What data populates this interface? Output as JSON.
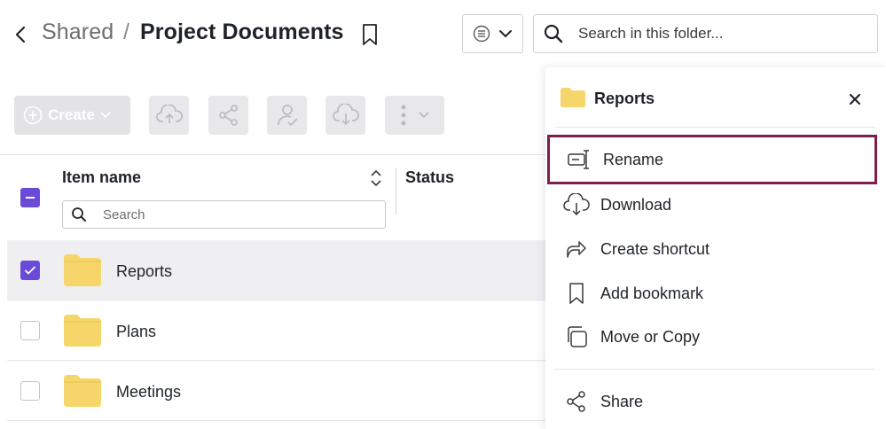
{
  "header": {
    "breadcrumb_parent": "Shared",
    "breadcrumb_separator": "/",
    "breadcrumb_current": "Project Documents"
  },
  "search": {
    "placeholder": "Search in this folder...",
    "value": ""
  },
  "toolbar": {
    "create_label": "Create",
    "icons": [
      "upload-icon",
      "share-icon",
      "assign-user-icon",
      "download-icon",
      "more-vertical-icon"
    ]
  },
  "table": {
    "columns": {
      "name": "Item name",
      "status": "Status"
    },
    "filter_placeholder": "Search",
    "rows": [
      {
        "name": "Reports",
        "selected": true
      },
      {
        "name": "Plans",
        "selected": false
      },
      {
        "name": "Meetings",
        "selected": false
      }
    ]
  },
  "context_menu": {
    "title": "Reports",
    "items": [
      {
        "label": "Rename",
        "icon": "rename-icon",
        "highlighted": true
      },
      {
        "label": "Download",
        "icon": "download-icon"
      },
      {
        "label": "Create shortcut",
        "icon": "shortcut-icon"
      },
      {
        "label": "Add bookmark",
        "icon": "bookmark-icon"
      },
      {
        "label": "Move or Copy",
        "icon": "copy-icon"
      },
      {
        "label": "Share",
        "icon": "share-icon"
      }
    ]
  },
  "colors": {
    "accent": "#6a4bd8",
    "highlight_border": "#7f1d4a",
    "folder": "#f6d56b",
    "selected_row": "#efeff1"
  }
}
